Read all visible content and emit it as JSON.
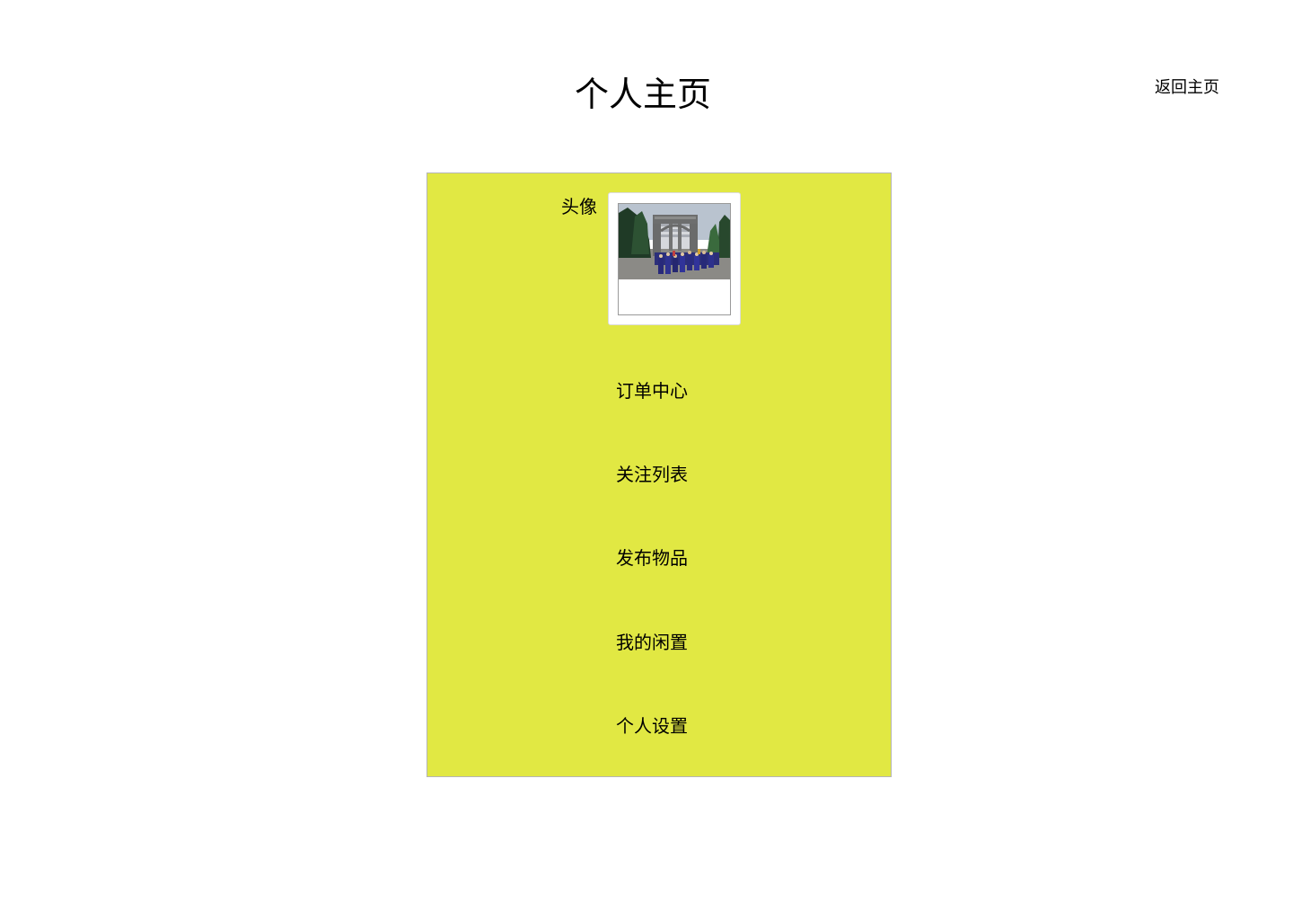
{
  "header": {
    "title": "个人主页",
    "back_link": "返回主页"
  },
  "panel": {
    "background_color": "#e1e843",
    "avatar": {
      "label": "头像",
      "image": "graduation-gate-photo"
    },
    "menu": [
      {
        "label": "订单中心"
      },
      {
        "label": "关注列表"
      },
      {
        "label": "发布物品"
      },
      {
        "label": "我的闲置"
      },
      {
        "label": "个人设置"
      }
    ]
  }
}
